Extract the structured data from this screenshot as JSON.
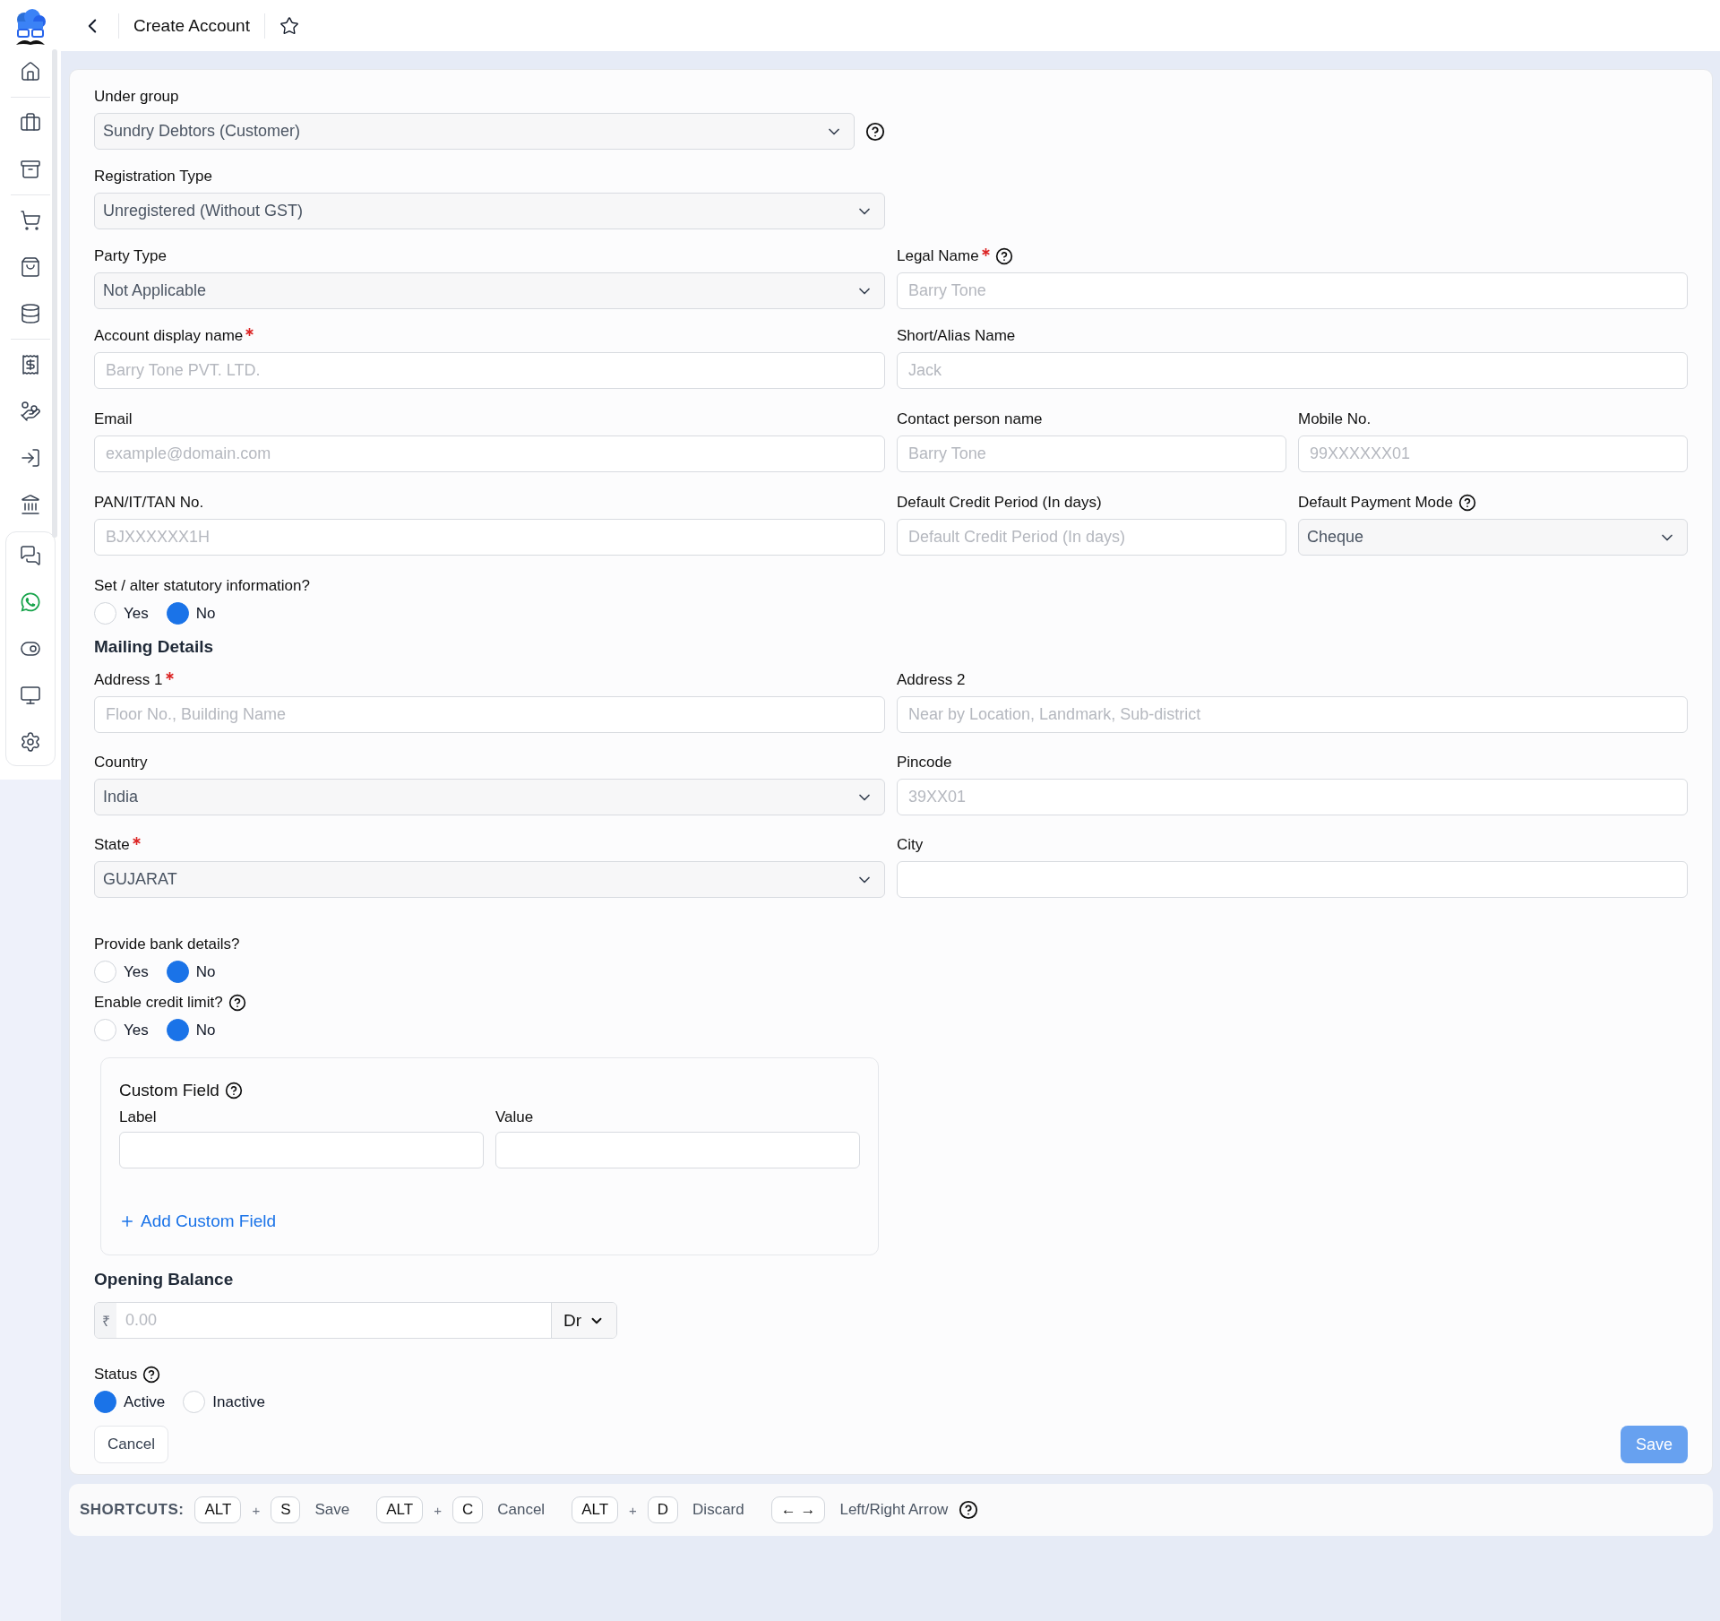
{
  "header": {
    "title": "Create Account"
  },
  "fields": {
    "under_group": {
      "label": "Under group",
      "kind": "select",
      "value": "Sundry Debtors (Customer)",
      "required": false,
      "help": true
    },
    "registration_type": {
      "label": "Registration Type",
      "kind": "select",
      "value": "Unregistered (Without GST)",
      "required": false,
      "help": false
    },
    "party_type": {
      "label": "Party Type",
      "kind": "select",
      "value": "Not Applicable",
      "required": false,
      "help": false
    },
    "legal_name": {
      "label": "Legal Name",
      "kind": "input",
      "placeholder": "Barry Tone",
      "required": true,
      "help": true
    },
    "account_display_name": {
      "label": "Account display name",
      "kind": "input",
      "placeholder": "Barry Tone PVT. LTD.",
      "required": true,
      "help": false
    },
    "short_alias_name": {
      "label": "Short/Alias Name",
      "kind": "input",
      "placeholder": "Jack",
      "required": false,
      "help": false
    },
    "email": {
      "label": "Email",
      "kind": "input",
      "placeholder": "example@domain.com",
      "required": false,
      "help": false
    },
    "contact_person_name": {
      "label": "Contact person name",
      "kind": "input",
      "placeholder": "Barry Tone",
      "required": false,
      "help": false
    },
    "mobile_no": {
      "label": "Mobile No.",
      "kind": "input",
      "placeholder": "99XXXXXX01",
      "required": false,
      "help": false
    },
    "pan_no": {
      "label": "PAN/IT/TAN No.",
      "kind": "input",
      "placeholder": "BJXXXXXX1H",
      "required": false,
      "help": false
    },
    "default_credit_period": {
      "label": "Default Credit Period (In days)",
      "kind": "input",
      "placeholder": "Default Credit Period (In days)",
      "required": false,
      "help": false
    },
    "default_payment_mode": {
      "label": "Default Payment Mode",
      "kind": "select",
      "value": "Cheque",
      "required": false,
      "help": true
    }
  },
  "statutory": {
    "label": "Set / alter statutory information?",
    "help": false,
    "options": [
      {
        "label": "Yes",
        "selected": false
      },
      {
        "label": "No",
        "selected": true
      }
    ]
  },
  "mailing": {
    "heading": "Mailing Details",
    "fields": [
      {
        "label": "Address 1",
        "kind": "input",
        "placeholder": "Floor No., Building Name",
        "required": true,
        "help": false
      },
      {
        "label": "Address 2",
        "kind": "input",
        "placeholder": "Near by Location, Landmark, Sub-district",
        "required": false,
        "help": false
      },
      {
        "label": "Country",
        "kind": "select",
        "value": "India",
        "required": false,
        "help": false
      },
      {
        "label": "Pincode",
        "kind": "input",
        "placeholder": "39XX01",
        "required": false,
        "help": false
      },
      {
        "label": "State",
        "kind": "select",
        "value": "GUJARAT",
        "required": true,
        "help": false
      },
      {
        "label": "City",
        "kind": "input",
        "required": false,
        "help": false
      }
    ]
  },
  "bank_details": {
    "label": "Provide bank details?",
    "help": false,
    "options": [
      {
        "label": "Yes",
        "selected": false
      },
      {
        "label": "No",
        "selected": true
      }
    ]
  },
  "credit_limit": {
    "label": "Enable credit limit?",
    "help": true,
    "options": [
      {
        "label": "Yes",
        "selected": false
      },
      {
        "label": "No",
        "selected": true
      }
    ]
  },
  "custom_field": {
    "title": "Custom Field",
    "help": true,
    "columns": [
      "Label",
      "Value"
    ],
    "add_button": "Add Custom Field"
  },
  "opening_balance": {
    "heading": "Opening Balance",
    "currency": "₹",
    "placeholder": "0.00",
    "side": "Dr"
  },
  "status": {
    "label": "Status",
    "help": true,
    "options": [
      {
        "label": "Active",
        "selected": true
      },
      {
        "label": "Inactive",
        "selected": false
      }
    ]
  },
  "buttons": {
    "cancel": "Cancel",
    "save": {
      "label": "Save",
      "disabled": true
    }
  },
  "shortcuts": {
    "label": "SHORTCUTS:",
    "items": [
      {
        "keys": [
          "ALT",
          "S"
        ],
        "joiner": "+",
        "action": "Save"
      },
      {
        "keys": [
          "ALT",
          "C"
        ],
        "joiner": "+",
        "action": "Cancel"
      },
      {
        "keys": [
          "ALT",
          "D"
        ],
        "joiner": "+",
        "action": "Discard"
      },
      {
        "keys": [
          "← →"
        ],
        "action": "Left/Right Arrow"
      }
    ],
    "help": true
  }
}
